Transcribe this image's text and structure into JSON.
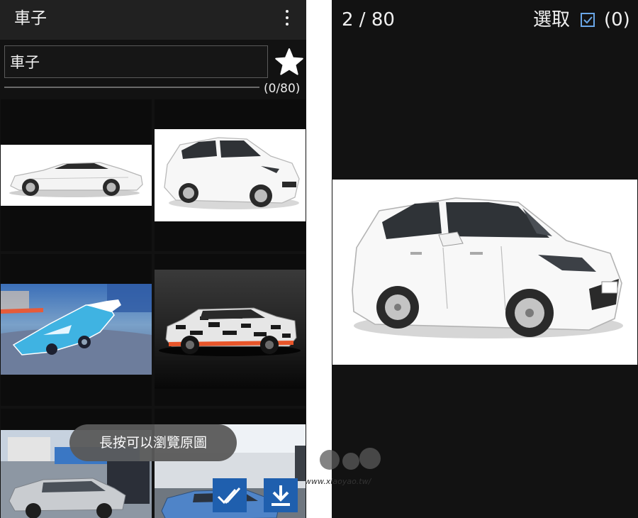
{
  "left_screen": {
    "title": "車子",
    "search": {
      "value": "車子"
    },
    "progress_fraction": 0,
    "count_label": "(0/80)",
    "toast": "長按可以瀏覽原圖",
    "thumbnails": [
      "white-sports-car",
      "white-hatchback",
      "blue-racing-car-game",
      "camouflage-suv",
      "grey-sedan-parking",
      "blue-car-with-person"
    ]
  },
  "right_screen": {
    "page_indicator": "2 / 80",
    "select_label": "選取",
    "select_count": "(0)",
    "viewer_image": "white-hatchback"
  },
  "watermark": {
    "text": "www.xiaoyao.tw/"
  },
  "colors": {
    "background": "#121212",
    "toolbar": "#212121",
    "fab": "#1f5fae",
    "toast": "#5a5a5a",
    "checkbox_accent": "#6aa7e8"
  }
}
